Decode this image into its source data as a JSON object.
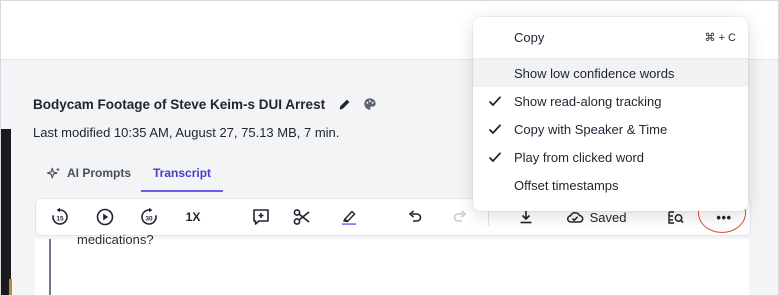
{
  "document": {
    "title": "Bodycam Footage of Steve Keim-s DUI Arrest",
    "meta": "Last modified 10:35 AM, August 27, 75.13 MB, 7 min."
  },
  "tabs": [
    {
      "label": "AI Prompts",
      "active": false,
      "icon": "sparkle-icon"
    },
    {
      "label": "Transcript",
      "active": true
    }
  ],
  "toolbar": {
    "rewind_icon": "rewind-15-icon",
    "play_icon": "play-icon",
    "forward_icon": "forward-30-icon",
    "speed_label": "1X",
    "add_comment_icon": "add-comment-icon",
    "cut_icon": "scissors-icon",
    "highlight_icon": "highlighter-icon",
    "undo_icon": "undo-icon",
    "redo_icon": "redo-icon",
    "download_icon": "download-icon",
    "saved_label": "Saved",
    "find_icon": "find-replace-icon",
    "more_label": "•••"
  },
  "editor": {
    "visible_text": "medications?"
  },
  "menu": {
    "items": [
      {
        "label": "Copy",
        "shortcut": "⌘ + C",
        "checked": false
      },
      {
        "label": "Show low confidence words",
        "checked": false,
        "highlighted": true
      },
      {
        "label": "Show read-along tracking",
        "checked": true
      },
      {
        "label": "Copy with Speaker & Time",
        "checked": true
      },
      {
        "label": "Play from clicked word",
        "checked": true
      },
      {
        "label": "Offset timestamps",
        "checked": false
      }
    ]
  },
  "colors": {
    "accent": "#4b3ad1",
    "annotation_ring": "#e24a3b",
    "menu_hover": "#f1f2f4"
  }
}
